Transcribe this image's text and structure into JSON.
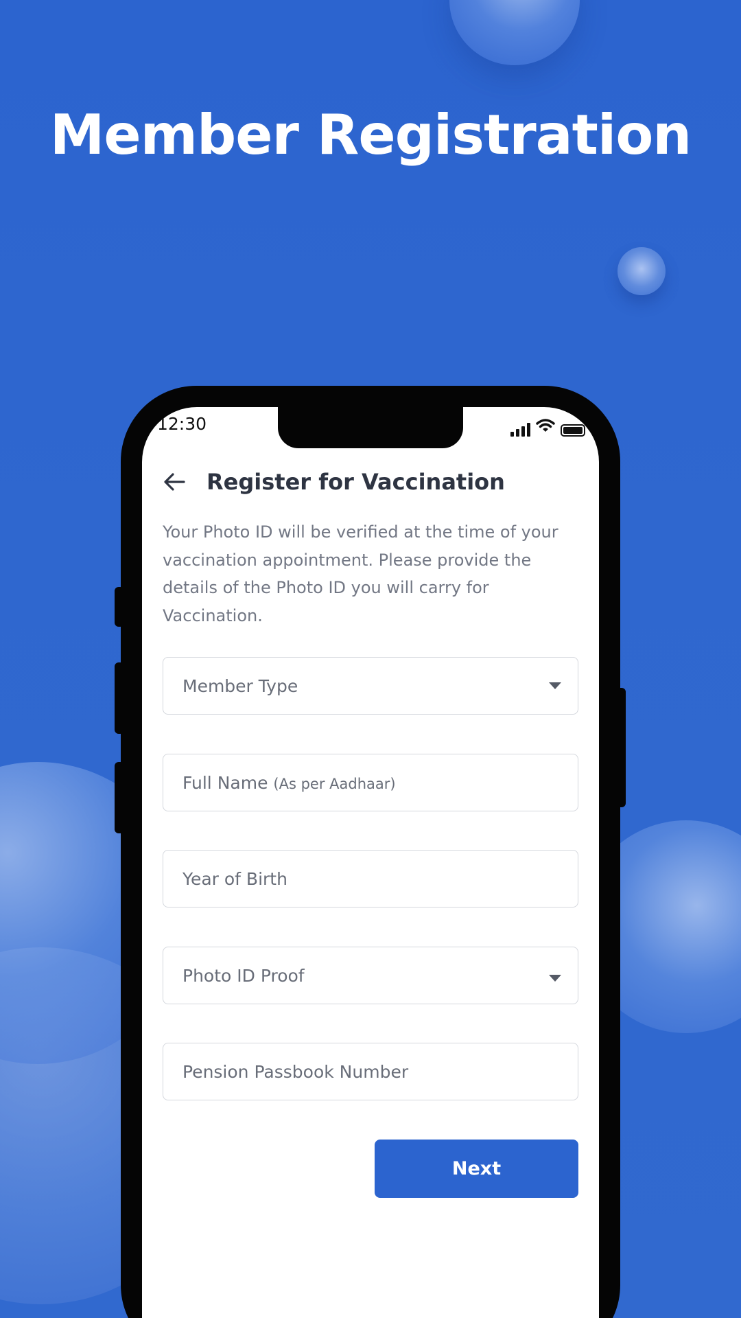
{
  "headline": "Member Registration",
  "status_bar": {
    "time": "12:30",
    "icons": [
      "signal-icon",
      "wifi-icon",
      "battery-icon"
    ]
  },
  "header": {
    "back_icon": "arrow-left-icon",
    "title": "Register for Vaccination"
  },
  "description": "Your Photo ID will be verified at the time of your vaccination appointment. Please provide the details of the Photo ID you will carry for Vaccination.",
  "form": {
    "member_type": {
      "label": "Member Type",
      "icon": "chevron-down-icon"
    },
    "full_name": {
      "label": "Full Name",
      "hint": "(As per Aadhaar)"
    },
    "year_of_birth": {
      "placeholder": "Year of Birth"
    },
    "photo_id_proof": {
      "label": "Photo ID Proof",
      "icon": "chevron-down-icon"
    },
    "pension_number": {
      "placeholder": "Pension Passbook Number"
    }
  },
  "next_button": "Next",
  "colors": {
    "background": "#2f68d0",
    "primary": "#2c64cf",
    "title_text": "#2e3442",
    "body_text": "#727784",
    "field_border": "#d4d7dd"
  }
}
